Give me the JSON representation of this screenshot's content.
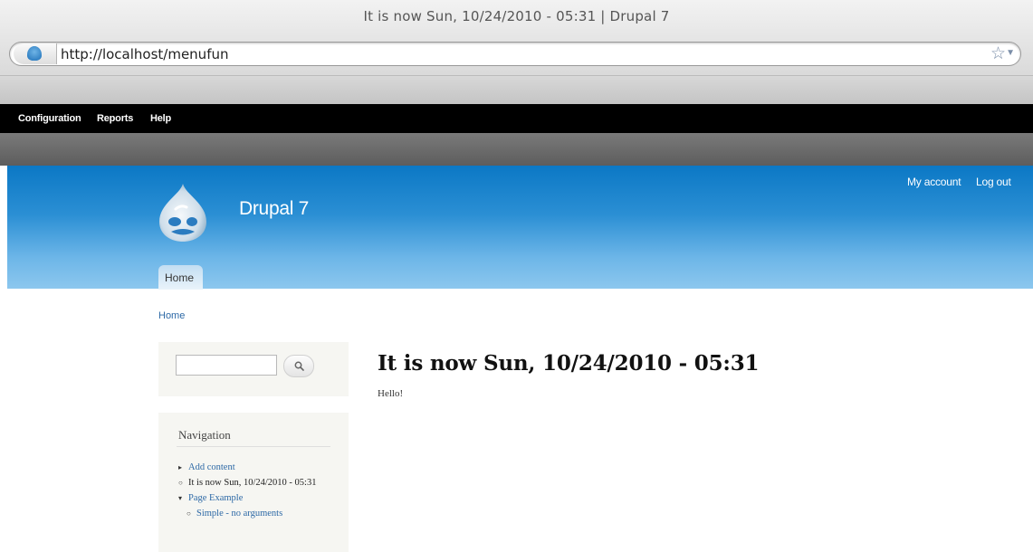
{
  "browser": {
    "window_title": "It is now Sun, 10/24/2010 - 05:31 | Drupal 7",
    "url": "http://localhost/menufun"
  },
  "admin_toolbar": {
    "items": [
      "Configuration",
      "Reports",
      "Help"
    ]
  },
  "header": {
    "site_name": "Drupal 7",
    "user_links": [
      "My account",
      "Log out"
    ],
    "tabs": [
      "Home"
    ]
  },
  "breadcrumb": "Home",
  "search": {
    "value": "",
    "button_icon": "magnifier-icon"
  },
  "navigation": {
    "title": "Navigation",
    "items": [
      {
        "label": "Add content",
        "bullet": "▸"
      },
      {
        "label": "It is now Sun, 10/24/2010 - 05:31",
        "bullet": "○"
      },
      {
        "label": "Page Example",
        "bullet": "▾"
      },
      {
        "label": "Simple - no arguments",
        "bullet": "○"
      }
    ]
  },
  "main": {
    "title": "It is now Sun, 10/24/2010 - 05:31",
    "body": "Hello!"
  },
  "colors": {
    "header_blue": "#0b78c5",
    "link_blue": "#2d69a6",
    "toolbar_black": "#000000"
  }
}
